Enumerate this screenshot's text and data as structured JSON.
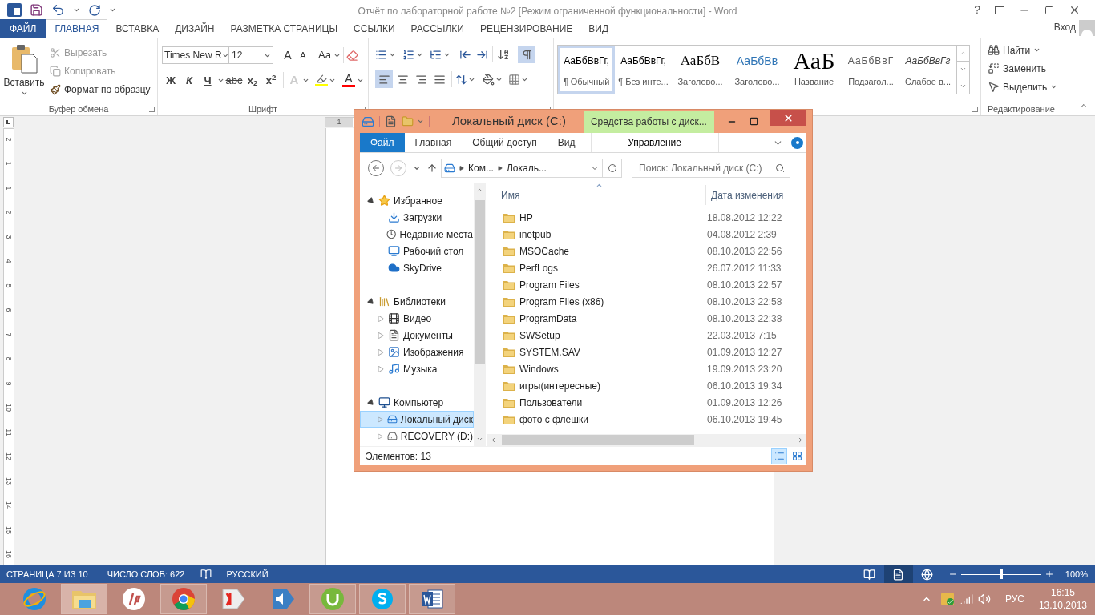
{
  "word": {
    "title": "Отчёт по лабораторной работе №2 [Режим ограниченной функциональности] - Word",
    "help": "?",
    "tabs": [
      {
        "label": "ФАЙЛ",
        "kind": "file",
        "selected": false
      },
      {
        "label": "ГЛАВНАЯ",
        "kind": "tab",
        "selected": true
      },
      {
        "label": "ВСТАВКА",
        "kind": "tab",
        "selected": false
      },
      {
        "label": "ДИЗАЙН",
        "kind": "tab",
        "selected": false
      },
      {
        "label": "РАЗМЕТКА СТРАНИЦЫ",
        "kind": "tab",
        "selected": false
      },
      {
        "label": "ССЫЛКИ",
        "kind": "tab",
        "selected": false
      },
      {
        "label": "РАССЫЛКИ",
        "kind": "tab",
        "selected": false
      },
      {
        "label": "РЕЦЕНЗИРОВАНИЕ",
        "kind": "tab",
        "selected": false
      },
      {
        "label": "ВИД",
        "kind": "tab",
        "selected": false
      }
    ],
    "account": "Вход",
    "ribbon": {
      "clipboard": {
        "paste": "Вставить",
        "label": "Буфер обмена",
        "items": [
          {
            "label": "Вырезать",
            "kind": "cut",
            "disabled": true
          },
          {
            "label": "Копировать",
            "kind": "copy",
            "disabled": true
          },
          {
            "label": "Формат по образцу",
            "kind": "painter",
            "disabled": false
          }
        ]
      },
      "font": {
        "name": "Times New R",
        "size": "12",
        "grow": "A",
        "shrink": "A",
        "case": "Aa",
        "effects": "A",
        "color_button": "A",
        "label": "Шрифт",
        "format": [
          {
            "text": "Ж",
            "kind": "bold"
          },
          {
            "text": "К",
            "kind": "italic"
          },
          {
            "text": "Ч",
            "kind": "underline"
          },
          {
            "text": "abc",
            "kind": "strike"
          },
          {
            "text": "x$_{2}$",
            "kind": "sub"
          },
          {
            "text": "x$^{2}$",
            "kind": "sup"
          }
        ]
      },
      "paragraph": {
        "show_marks": true,
        "align": [
          {
            "kind": "left",
            "selected": true
          },
          {
            "kind": "center",
            "selected": false
          },
          {
            "kind": "right",
            "selected": false
          },
          {
            "kind": "justify",
            "selected": false
          }
        ]
      },
      "styles": {
        "items": [
          {
            "sample": "АаБбВвГг,",
            "name": "¶ Обычный",
            "kind": "normal",
            "selected": true
          },
          {
            "sample": "АаБбВвГг,",
            "name": "¶ Без инте...",
            "kind": "normal",
            "selected": false
          },
          {
            "sample": "АаБбВ",
            "name": "Заголово...",
            "kind": "heading1",
            "selected": false
          },
          {
            "sample": "АаБбВв",
            "name": "Заголово...",
            "kind": "heading2",
            "selected": false
          },
          {
            "sample": "АаБ",
            "name": "Название",
            "kind": "title",
            "selected": false
          },
          {
            "sample": "АаБбВвГ",
            "name": "Подзагол...",
            "kind": "subtitle",
            "selected": false
          },
          {
            "sample": "АаБбВвГг",
            "name": "Слабое в...",
            "kind": "emphasis",
            "selected": false
          }
        ]
      },
      "editing": {
        "label": "Редактирование",
        "items": [
          {
            "label": "Найти",
            "kind": "find"
          },
          {
            "label": "Заменить",
            "kind": "replace"
          },
          {
            "label": "Выделить",
            "kind": "select"
          }
        ]
      }
    },
    "ruler": {
      "horizontal": [
        "1"
      ],
      "vertical": [
        "2",
        "1",
        "1",
        "2",
        "3",
        "4",
        "5",
        "6",
        "7",
        "8",
        "9",
        "10",
        "11",
        "12",
        "13",
        "14",
        "15",
        "16"
      ]
    },
    "status_bar": {
      "page": "СТРАНИЦА 7 ИЗ 10",
      "words": "ЧИСЛО СЛОВ: 622",
      "language": "РУССКИЙ",
      "views": [
        {
          "kind": "read",
          "selected": false
        },
        {
          "kind": "print",
          "selected": true
        },
        {
          "kind": "web",
          "selected": false
        }
      ],
      "zoom": {
        "level": 0.5,
        "reading": "100%"
      }
    }
  },
  "explorer": {
    "title": "Локальный диск (C:)",
    "context_tab": "Средства работы с диск...",
    "tabs": [
      {
        "label": "Файл",
        "kind": "file",
        "selected": false
      },
      {
        "label": "Главная",
        "kind": "tab",
        "selected": false
      },
      {
        "label": "Общий доступ",
        "kind": "tab",
        "selected": false
      },
      {
        "label": "Вид",
        "kind": "tab",
        "selected": false
      },
      {
        "label": "Управление",
        "kind": "context",
        "selected": false
      }
    ],
    "address": [
      "Ком...",
      "Локаль..."
    ],
    "search": {
      "placeholder": "Поиск: Локальный диск (C:)"
    },
    "nav": [
      {
        "label": "Избранное",
        "kind": "star",
        "expanded": true,
        "selected": false,
        "children": [
          {
            "label": "Загрузки",
            "kind": "downloads",
            "selected": false
          },
          {
            "label": "Недавние места",
            "kind": "recent",
            "selected": false
          },
          {
            "label": "Рабочий стол",
            "kind": "desktop",
            "selected": false
          },
          {
            "label": "SkyDrive",
            "kind": "cloud",
            "selected": false
          }
        ]
      },
      {
        "label": "Библиотеки",
        "kind": "library",
        "expanded": true,
        "selected": false,
        "children": [
          {
            "label": "Видео",
            "kind": "video",
            "expanded": false,
            "selected": false
          },
          {
            "label": "Документы",
            "kind": "documents",
            "expanded": false,
            "selected": false
          },
          {
            "label": "Изображения",
            "kind": "images",
            "expanded": false,
            "selected": false
          },
          {
            "label": "Музыка",
            "kind": "music",
            "expanded": false,
            "selected": false
          }
        ]
      },
      {
        "label": "Компьютер",
        "kind": "computer",
        "expanded": true,
        "selected": false,
        "children": [
          {
            "label": "Локальный диск",
            "kind": "disk",
            "expanded": false,
            "selected": true
          },
          {
            "label": "RECOVERY (D:)",
            "kind": "drive",
            "expanded": false,
            "selected": false
          }
        ]
      }
    ],
    "columns": [
      "Имя",
      "Дата изменения"
    ],
    "rows": [
      {
        "name": "HP",
        "date": "18.08.2012 12:22"
      },
      {
        "name": "inetpub",
        "date": "04.08.2012 2:39"
      },
      {
        "name": "MSOCache",
        "date": "08.10.2013 22:56"
      },
      {
        "name": "PerfLogs",
        "date": "26.07.2012 11:33"
      },
      {
        "name": "Program Files",
        "date": "08.10.2013 22:57"
      },
      {
        "name": "Program Files (x86)",
        "date": "08.10.2013 22:58"
      },
      {
        "name": "ProgramData",
        "date": "08.10.2013 22:38"
      },
      {
        "name": "SWSetup",
        "date": "22.03.2013 7:15"
      },
      {
        "name": "SYSTEM.SAV",
        "date": "01.09.2013 12:27"
      },
      {
        "name": "Windows",
        "date": "19.09.2013 23:20"
      },
      {
        "name": "игры(интересные)",
        "date": "06.10.2013 19:34"
      },
      {
        "name": "Пользователи",
        "date": "01.09.2013 12:26"
      },
      {
        "name": "фото с флешки",
        "date": "06.10.2013 19:45"
      }
    ],
    "status": "Элементов: 13",
    "views": [
      {
        "kind": "details",
        "selected": true
      },
      {
        "kind": "tiles",
        "selected": false
      }
    ]
  },
  "taskbar": {
    "apps": [
      {
        "kind": "ie",
        "running": false,
        "selected": false
      },
      {
        "kind": "explorer",
        "running": true,
        "selected": true
      },
      {
        "kind": "hp",
        "running": false,
        "selected": false
      },
      {
        "kind": "chrome",
        "running": true,
        "selected": false
      },
      {
        "kind": "yandex",
        "running": false,
        "selected": false
      },
      {
        "kind": "sound",
        "running": false,
        "selected": false
      },
      {
        "kind": "utorrent",
        "running": true,
        "selected": false
      },
      {
        "kind": "skype",
        "running": true,
        "selected": false
      },
      {
        "kind": "word",
        "running": true,
        "selected": false
      }
    ],
    "tray": {
      "language": "РУС",
      "time": "16:15",
      "date": "13.10.2013"
    }
  }
}
